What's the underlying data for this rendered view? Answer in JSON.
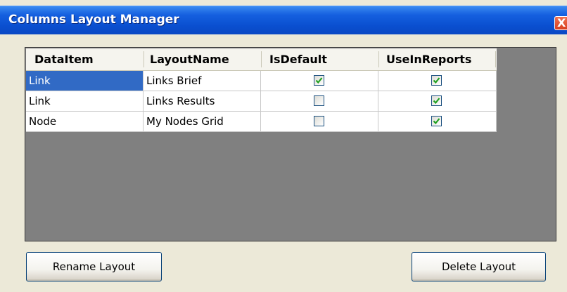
{
  "window": {
    "title": "Columns Layout Manager",
    "close_glyph": "X"
  },
  "grid": {
    "columns": [
      "DataItem",
      "LayoutName",
      "IsDefault",
      "UseInReports"
    ],
    "rows": [
      {
        "data_item": "Link",
        "layout_name": "Links Brief",
        "is_default": true,
        "use_in_reports": true,
        "selected": true
      },
      {
        "data_item": "Link",
        "layout_name": "Links Results",
        "is_default": false,
        "use_in_reports": true,
        "selected": false
      },
      {
        "data_item": "Node",
        "layout_name": "My Nodes Grid",
        "is_default": false,
        "use_in_reports": true,
        "selected": false
      }
    ]
  },
  "buttons": {
    "rename": "Rename Layout",
    "delete": "Delete Layout"
  },
  "colors": {
    "titlebar": "#0a4fd0",
    "selection": "#316ac5",
    "grid_background": "#808080",
    "check_mark": "#21a121"
  }
}
